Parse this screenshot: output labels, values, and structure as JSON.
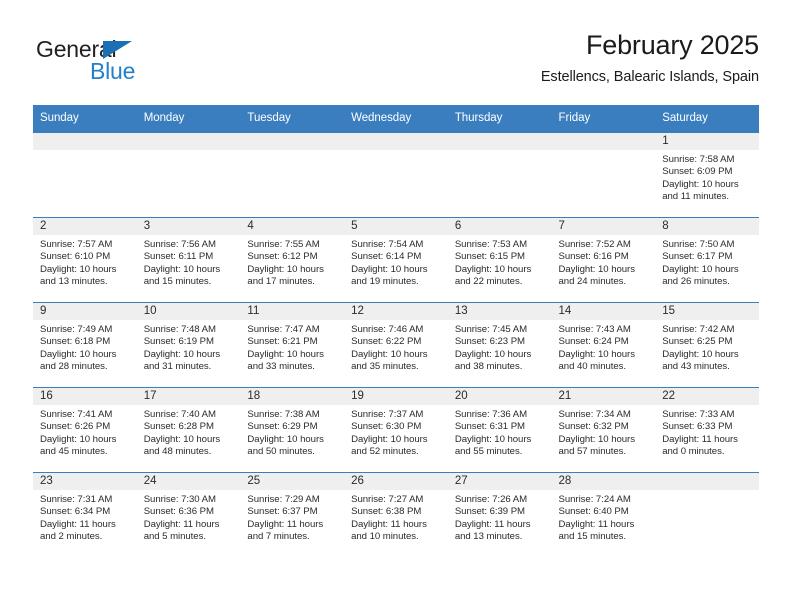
{
  "brand": {
    "name_top": "General",
    "name_bottom": "Blue",
    "triangle_icon": "brand-triangle-icon",
    "color_dark": "#231f20",
    "color_blue": "#2281c8"
  },
  "header": {
    "title": "February 2025",
    "subtitle": "Estellencs, Balearic Islands, Spain"
  },
  "theme": {
    "header_bg": "#3a7ebf",
    "header_text": "#ffffff",
    "daynum_bg": "#efefef",
    "cell_border": "#3a7ebf",
    "body_text": "#2b2b2b"
  },
  "calendar": {
    "weekday_headers": [
      "Sunday",
      "Monday",
      "Tuesday",
      "Wednesday",
      "Thursday",
      "Friday",
      "Saturday"
    ],
    "labels": {
      "sunrise": "Sunrise:",
      "sunset": "Sunset:",
      "daylight": "Daylight:"
    },
    "weeks": [
      [
        {
          "empty": true
        },
        {
          "empty": true
        },
        {
          "empty": true
        },
        {
          "empty": true
        },
        {
          "empty": true
        },
        {
          "empty": true
        },
        {
          "day": "1",
          "sunrise": "Sunrise: 7:58 AM",
          "sunset": "Sunset: 6:09 PM",
          "daylight": "Daylight: 10 hours and 11 minutes."
        }
      ],
      [
        {
          "day": "2",
          "sunrise": "Sunrise: 7:57 AM",
          "sunset": "Sunset: 6:10 PM",
          "daylight": "Daylight: 10 hours and 13 minutes."
        },
        {
          "day": "3",
          "sunrise": "Sunrise: 7:56 AM",
          "sunset": "Sunset: 6:11 PM",
          "daylight": "Daylight: 10 hours and 15 minutes."
        },
        {
          "day": "4",
          "sunrise": "Sunrise: 7:55 AM",
          "sunset": "Sunset: 6:12 PM",
          "daylight": "Daylight: 10 hours and 17 minutes."
        },
        {
          "day": "5",
          "sunrise": "Sunrise: 7:54 AM",
          "sunset": "Sunset: 6:14 PM",
          "daylight": "Daylight: 10 hours and 19 minutes."
        },
        {
          "day": "6",
          "sunrise": "Sunrise: 7:53 AM",
          "sunset": "Sunset: 6:15 PM",
          "daylight": "Daylight: 10 hours and 22 minutes."
        },
        {
          "day": "7",
          "sunrise": "Sunrise: 7:52 AM",
          "sunset": "Sunset: 6:16 PM",
          "daylight": "Daylight: 10 hours and 24 minutes."
        },
        {
          "day": "8",
          "sunrise": "Sunrise: 7:50 AM",
          "sunset": "Sunset: 6:17 PM",
          "daylight": "Daylight: 10 hours and 26 minutes."
        }
      ],
      [
        {
          "day": "9",
          "sunrise": "Sunrise: 7:49 AM",
          "sunset": "Sunset: 6:18 PM",
          "daylight": "Daylight: 10 hours and 28 minutes."
        },
        {
          "day": "10",
          "sunrise": "Sunrise: 7:48 AM",
          "sunset": "Sunset: 6:19 PM",
          "daylight": "Daylight: 10 hours and 31 minutes."
        },
        {
          "day": "11",
          "sunrise": "Sunrise: 7:47 AM",
          "sunset": "Sunset: 6:21 PM",
          "daylight": "Daylight: 10 hours and 33 minutes."
        },
        {
          "day": "12",
          "sunrise": "Sunrise: 7:46 AM",
          "sunset": "Sunset: 6:22 PM",
          "daylight": "Daylight: 10 hours and 35 minutes."
        },
        {
          "day": "13",
          "sunrise": "Sunrise: 7:45 AM",
          "sunset": "Sunset: 6:23 PM",
          "daylight": "Daylight: 10 hours and 38 minutes."
        },
        {
          "day": "14",
          "sunrise": "Sunrise: 7:43 AM",
          "sunset": "Sunset: 6:24 PM",
          "daylight": "Daylight: 10 hours and 40 minutes."
        },
        {
          "day": "15",
          "sunrise": "Sunrise: 7:42 AM",
          "sunset": "Sunset: 6:25 PM",
          "daylight": "Daylight: 10 hours and 43 minutes."
        }
      ],
      [
        {
          "day": "16",
          "sunrise": "Sunrise: 7:41 AM",
          "sunset": "Sunset: 6:26 PM",
          "daylight": "Daylight: 10 hours and 45 minutes."
        },
        {
          "day": "17",
          "sunrise": "Sunrise: 7:40 AM",
          "sunset": "Sunset: 6:28 PM",
          "daylight": "Daylight: 10 hours and 48 minutes."
        },
        {
          "day": "18",
          "sunrise": "Sunrise: 7:38 AM",
          "sunset": "Sunset: 6:29 PM",
          "daylight": "Daylight: 10 hours and 50 minutes."
        },
        {
          "day": "19",
          "sunrise": "Sunrise: 7:37 AM",
          "sunset": "Sunset: 6:30 PM",
          "daylight": "Daylight: 10 hours and 52 minutes."
        },
        {
          "day": "20",
          "sunrise": "Sunrise: 7:36 AM",
          "sunset": "Sunset: 6:31 PM",
          "daylight": "Daylight: 10 hours and 55 minutes."
        },
        {
          "day": "21",
          "sunrise": "Sunrise: 7:34 AM",
          "sunset": "Sunset: 6:32 PM",
          "daylight": "Daylight: 10 hours and 57 minutes."
        },
        {
          "day": "22",
          "sunrise": "Sunrise: 7:33 AM",
          "sunset": "Sunset: 6:33 PM",
          "daylight": "Daylight: 11 hours and 0 minutes."
        }
      ],
      [
        {
          "day": "23",
          "sunrise": "Sunrise: 7:31 AM",
          "sunset": "Sunset: 6:34 PM",
          "daylight": "Daylight: 11 hours and 2 minutes."
        },
        {
          "day": "24",
          "sunrise": "Sunrise: 7:30 AM",
          "sunset": "Sunset: 6:36 PM",
          "daylight": "Daylight: 11 hours and 5 minutes."
        },
        {
          "day": "25",
          "sunrise": "Sunrise: 7:29 AM",
          "sunset": "Sunset: 6:37 PM",
          "daylight": "Daylight: 11 hours and 7 minutes."
        },
        {
          "day": "26",
          "sunrise": "Sunrise: 7:27 AM",
          "sunset": "Sunset: 6:38 PM",
          "daylight": "Daylight: 11 hours and 10 minutes."
        },
        {
          "day": "27",
          "sunrise": "Sunrise: 7:26 AM",
          "sunset": "Sunset: 6:39 PM",
          "daylight": "Daylight: 11 hours and 13 minutes."
        },
        {
          "day": "28",
          "sunrise": "Sunrise: 7:24 AM",
          "sunset": "Sunset: 6:40 PM",
          "daylight": "Daylight: 11 hours and 15 minutes."
        },
        {
          "empty": true
        }
      ]
    ]
  }
}
